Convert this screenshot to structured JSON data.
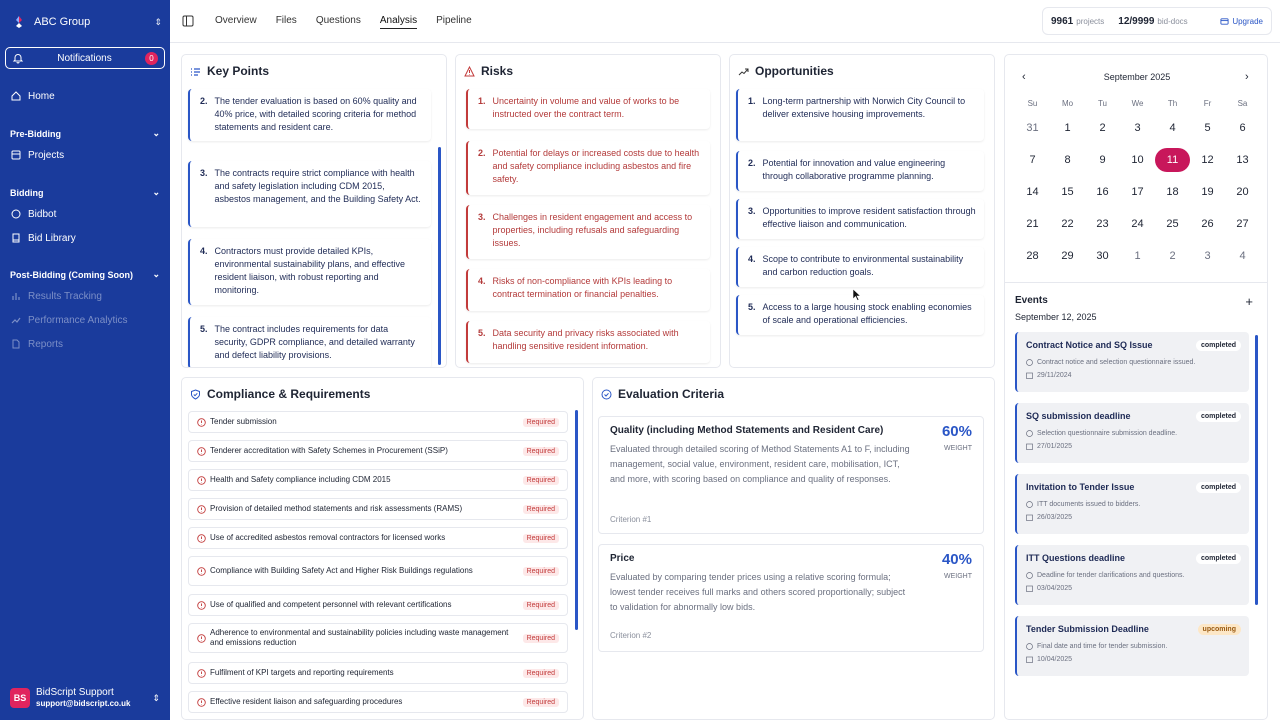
{
  "org": {
    "name": "ABC Group"
  },
  "notifications": {
    "label": "Notifications",
    "count": "0"
  },
  "sidebar": {
    "home": "Home",
    "pre_bidding": "Pre-Bidding",
    "projects": "Projects",
    "bidding": "Bidding",
    "bidbot": "Bidbot",
    "bid_library": "Bid Library",
    "post_bidding": "Post-Bidding (Coming Soon)",
    "results_tracking": "Results Tracking",
    "performance_analytics": "Performance Analytics",
    "reports": "Reports"
  },
  "user": {
    "initials": "BS",
    "name": "BidScript Support",
    "email": "support@bidscript.co.uk"
  },
  "tabs": [
    "Overview",
    "Files",
    "Questions",
    "Analysis",
    "Pipeline"
  ],
  "usage": {
    "projects": "9961",
    "projects_unit": "projects",
    "docs": "12/9999",
    "docs_unit": "bid-docs",
    "upgrade": "Upgrade"
  },
  "key_points": {
    "title": "Key Points",
    "items": [
      {
        "num": "2.",
        "text": "The tender evaluation is based on 60% quality and 40% price, with detailed scoring criteria for method statements and resident care."
      },
      {
        "num": "3.",
        "text": "The contracts require strict compliance with health and safety legislation including CDM 2015, asbestos management, and the Building Safety Act."
      },
      {
        "num": "4.",
        "text": "Contractors must provide detailed KPIs, environmental sustainability plans, and effective resident liaison, with robust reporting and monitoring."
      },
      {
        "num": "5.",
        "text": "The contract includes requirements for data security, GDPR compliance, and detailed warranty and defect liability provisions."
      }
    ]
  },
  "risks": {
    "title": "Risks",
    "items": [
      {
        "num": "1.",
        "text": "Uncertainty in volume and value of works to be instructed over the contract term."
      },
      {
        "num": "2.",
        "text": "Potential for delays or increased costs due to health and safety compliance including asbestos and fire safety."
      },
      {
        "num": "3.",
        "text": "Challenges in resident engagement and access to properties, including refusals and safeguarding issues."
      },
      {
        "num": "4.",
        "text": "Risks of non-compliance with KPIs leading to contract termination or financial penalties."
      },
      {
        "num": "5.",
        "text": "Data security and privacy risks associated with handling sensitive resident information."
      }
    ]
  },
  "opportunities": {
    "title": "Opportunities",
    "items": [
      {
        "num": "1.",
        "text": "Long-term partnership with Norwich City Council to deliver extensive housing improvements."
      },
      {
        "num": "2.",
        "text": "Potential for innovation and value engineering through collaborative programme planning."
      },
      {
        "num": "3.",
        "text": "Opportunities to improve resident satisfaction through effective liaison and communication."
      },
      {
        "num": "4.",
        "text": "Scope to contribute to environmental sustainability and carbon reduction goals."
      },
      {
        "num": "5.",
        "text": "Access to a large housing stock enabling economies of scale and operational efficiencies."
      }
    ]
  },
  "compliance": {
    "title": "Compliance & Requirements",
    "required_label": "Required",
    "items": [
      "Tender submission",
      "Tenderer accreditation with Safety Schemes in Procurement (SSiP)",
      "Health and Safety compliance including CDM 2015",
      "Provision of detailed method statements and risk assessments (RAMS)",
      "Use of accredited asbestos removal contractors for licensed works",
      "Compliance with Building Safety Act and Higher Risk Buildings regulations",
      "Use of qualified and competent personnel with relevant certifications",
      "Adherence to environmental and sustainability policies including waste management and emissions reduction",
      "Fulfilment of KPI targets and reporting requirements",
      "Effective resident liaison and safeguarding procedures"
    ]
  },
  "evaluation": {
    "title": "Evaluation Criteria",
    "weight_label": "WEIGHT",
    "criteria": [
      {
        "title": "Quality (including Method Statements and Resident Care)",
        "pct": "60%",
        "desc": "Evaluated through detailed scoring of Method Statements A1 to F, including management, social value, environment, resident care, mobilisation, ICT, and more, with scoring based on compliance and quality of responses.",
        "num": "Criterion #1"
      },
      {
        "title": "Price",
        "pct": "40%",
        "desc": "Evaluated by comparing tender prices using a relative scoring formula; lowest tender receives full marks and others scored proportionally; subject to validation for abnormally low bids.",
        "num": "Criterion #2"
      }
    ]
  },
  "calendar": {
    "month": "September 2025",
    "dow": [
      "Su",
      "Mo",
      "Tu",
      "We",
      "Th",
      "Fr",
      "Sa"
    ],
    "weeks": [
      [
        "31",
        "1",
        "2",
        "3",
        "4",
        "5",
        "6"
      ],
      [
        "7",
        "8",
        "9",
        "10",
        "11",
        "12",
        "13"
      ],
      [
        "14",
        "15",
        "16",
        "17",
        "18",
        "19",
        "20"
      ],
      [
        "21",
        "22",
        "23",
        "24",
        "25",
        "26",
        "27"
      ],
      [
        "28",
        "29",
        "30",
        "1",
        "2",
        "3",
        "4"
      ]
    ],
    "selected": "11"
  },
  "events": {
    "title": "Events",
    "date": "September 12, 2025",
    "items": [
      {
        "name": "Contract Notice and SQ Issue",
        "status": "completed",
        "desc": "Contract notice and selection questionnaire issued.",
        "date": "29/11/2024"
      },
      {
        "name": "SQ submission deadline",
        "status": "completed",
        "desc": "Selection questionnaire submission deadline.",
        "date": "27/01/2025"
      },
      {
        "name": "Invitation to Tender Issue",
        "status": "completed",
        "desc": "ITT documents issued to bidders.",
        "date": "26/03/2025"
      },
      {
        "name": "ITT Questions deadline",
        "status": "completed",
        "desc": "Deadline for tender clarifications and questions.",
        "date": "03/04/2025"
      },
      {
        "name": "Tender Submission Deadline",
        "status": "upcoming",
        "desc": "Final date and time for tender submission.",
        "date": "10/04/2025"
      }
    ]
  },
  "colors": {
    "sidebar": "#1a3b9c",
    "accent": "#2a56c6",
    "risk": "#c23b3b",
    "selected_day": "#c8175b",
    "upcoming": "#fde7c6"
  }
}
